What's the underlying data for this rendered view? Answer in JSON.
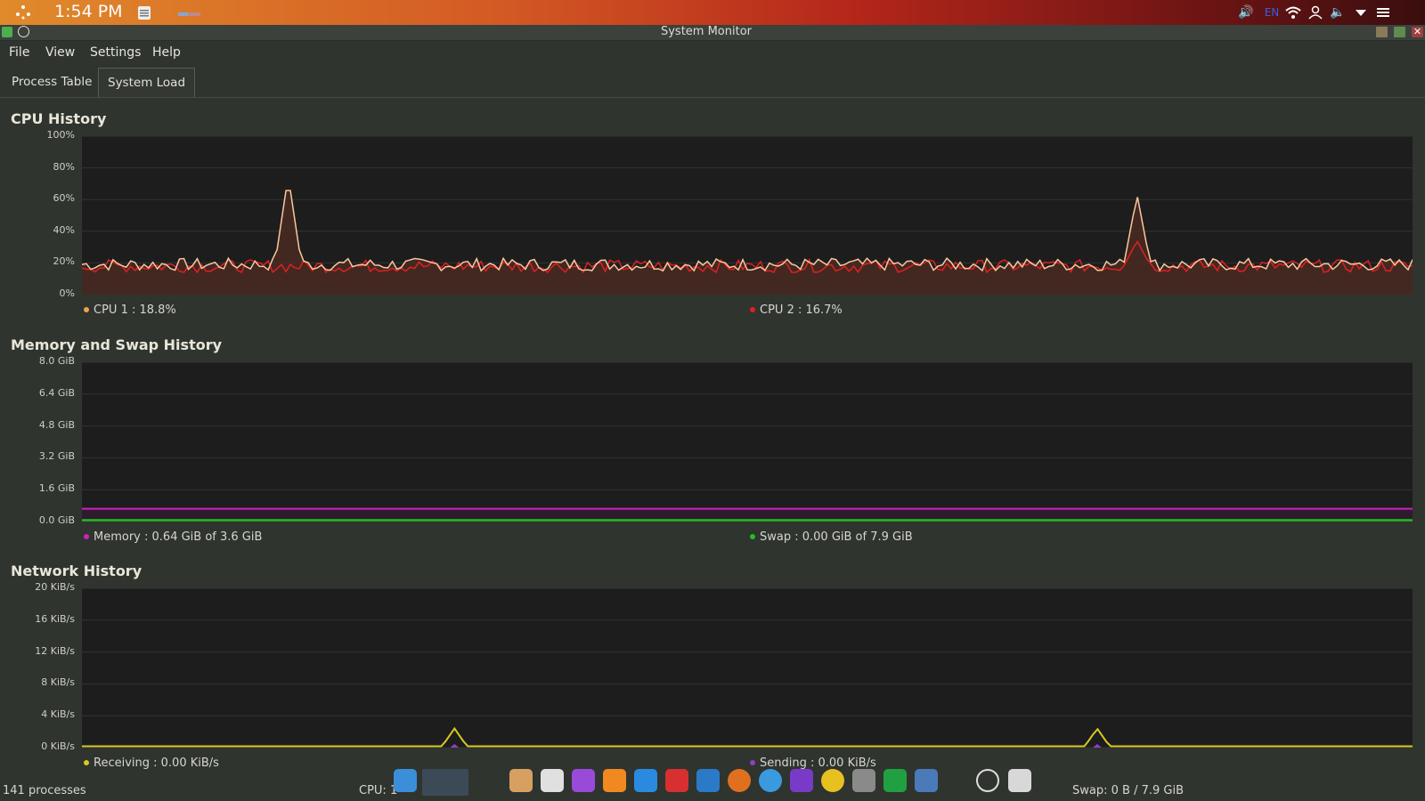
{
  "topbar": {
    "time": "1:54 PM",
    "language": "EN"
  },
  "window": {
    "title": "System Monitor"
  },
  "menu": {
    "file": "File",
    "view": "View",
    "settings": "Settings",
    "help": "Help"
  },
  "tabs": {
    "process_table": "Process Table",
    "system_load": "System Load"
  },
  "cpu": {
    "title": "CPU History",
    "yticks": [
      "100%",
      "80%",
      "60%",
      "40%",
      "20%",
      "0%"
    ],
    "legend1": "CPU 1 : 18.8%",
    "legend2": "CPU 2 : 16.7%",
    "color1": "#f0a050",
    "color2": "#e02020"
  },
  "memory": {
    "title": "Memory and Swap History",
    "yticks": [
      "8.0 GiB",
      "6.4 GiB",
      "4.8 GiB",
      "3.2 GiB",
      "1.6 GiB",
      "0.0 GiB"
    ],
    "legend1": "Memory : 0.64 GiB of 3.6 GiB",
    "legend2": "Swap : 0.00 GiB of 7.9 GiB",
    "color1": "#d020c0",
    "color2": "#20c020"
  },
  "network": {
    "title": "Network History",
    "yticks": [
      "20 KiB/s",
      "16 KiB/s",
      "12 KiB/s",
      "8 KiB/s",
      "4 KiB/s",
      "0 KiB/s"
    ],
    "legend1": "Receiving : 0.00 KiB/s",
    "legend2": "Sending : 0.00 KiB/s",
    "color1": "#d8c820",
    "color2": "#9040c0"
  },
  "status": {
    "processes": "141 processes",
    "cpu_partial": "CPU: 1",
    "swap": "Swap: 0 B / 7.9 GiB"
  },
  "chart_data": [
    {
      "type": "line",
      "title": "CPU History",
      "ylim": [
        0,
        100
      ],
      "yunit": "%",
      "series": [
        {
          "name": "CPU 1",
          "current": 18.8,
          "baseline": 19,
          "peaks": [
            {
              "pos": 0.155,
              "value": 75
            },
            {
              "pos": 0.793,
              "value": 63
            }
          ]
        },
        {
          "name": "CPU 2",
          "current": 16.7,
          "baseline": 18,
          "peaks": [
            {
              "pos": 0.793,
              "value": 34
            }
          ]
        }
      ]
    },
    {
      "type": "line",
      "title": "Memory and Swap History",
      "ylim": [
        0,
        8
      ],
      "yunit": "GiB",
      "series": [
        {
          "name": "Memory",
          "value": 0.64
        },
        {
          "name": "Swap",
          "value": 0.0
        }
      ]
    },
    {
      "type": "line",
      "title": "Network History",
      "ylim": [
        0,
        20
      ],
      "yunit": "KiB/s",
      "series": [
        {
          "name": "Receiving",
          "value": 0.0,
          "peaks": [
            {
              "pos": 0.28,
              "value": 2.4
            },
            {
              "pos": 0.763,
              "value": 2.4
            }
          ]
        },
        {
          "name": "Sending",
          "value": 0.0
        }
      ]
    }
  ]
}
